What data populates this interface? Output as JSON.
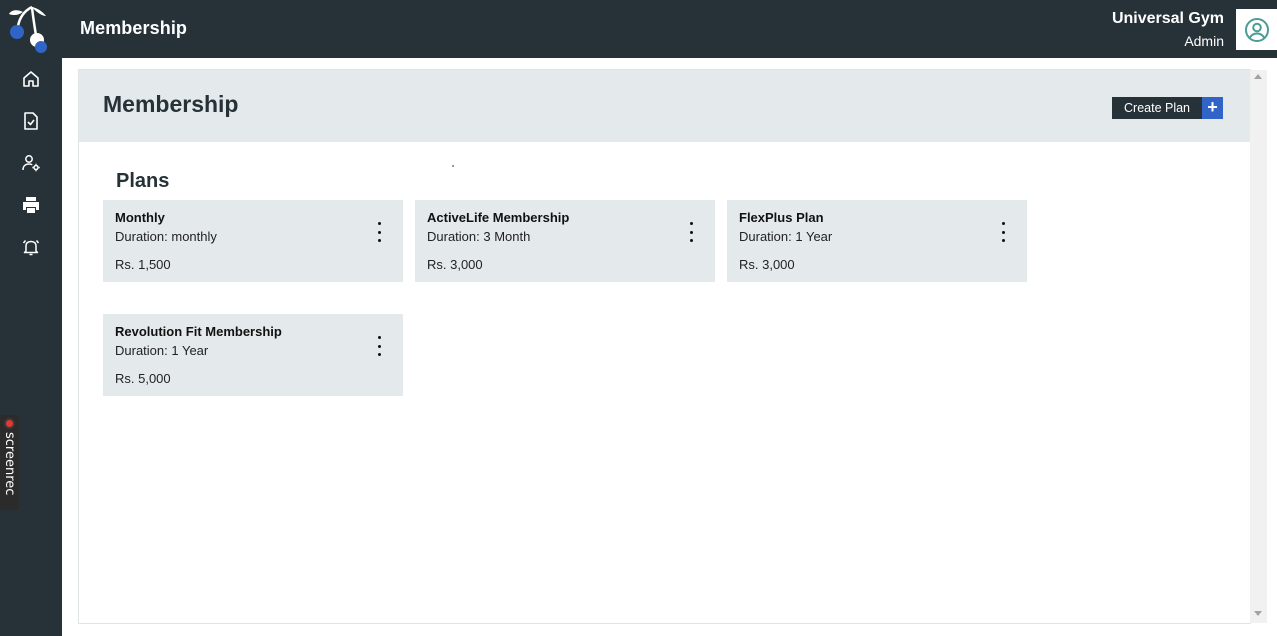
{
  "app": {
    "page_title": "Membership",
    "org_name": "Universal Gym",
    "user_role": "Admin"
  },
  "sidebar": {
    "items": [
      {
        "icon": "home-icon"
      },
      {
        "icon": "task-checklist-icon"
      },
      {
        "icon": "user-settings-icon"
      },
      {
        "icon": "printer-icon"
      },
      {
        "icon": "alarm-bell-icon"
      }
    ]
  },
  "screenrec": {
    "label": "screenrec"
  },
  "main": {
    "header_title": "Membership",
    "create_button_label": "Create Plan",
    "create_button_icon": "+",
    "plans_title": "Plans",
    "plans": [
      {
        "name": "Monthly",
        "duration": "Duration: monthly",
        "price": "Rs. 1,500"
      },
      {
        "name": "ActiveLife Membership",
        "duration": "Duration: 3 Month",
        "price": "Rs. 3,000"
      },
      {
        "name": "FlexPlus Plan",
        "duration": "Duration: 1 Year",
        "price": "Rs. 3,000"
      },
      {
        "name": "Revolution Fit Membership",
        "duration": "Duration: 1 Year",
        "price": "Rs. 5,000"
      }
    ]
  },
  "colors": {
    "sidebar_bg": "#263238",
    "header_bg": "#e4eaec",
    "accent_blue": "#3164c7",
    "avatar_teal": "#4a9c95"
  }
}
